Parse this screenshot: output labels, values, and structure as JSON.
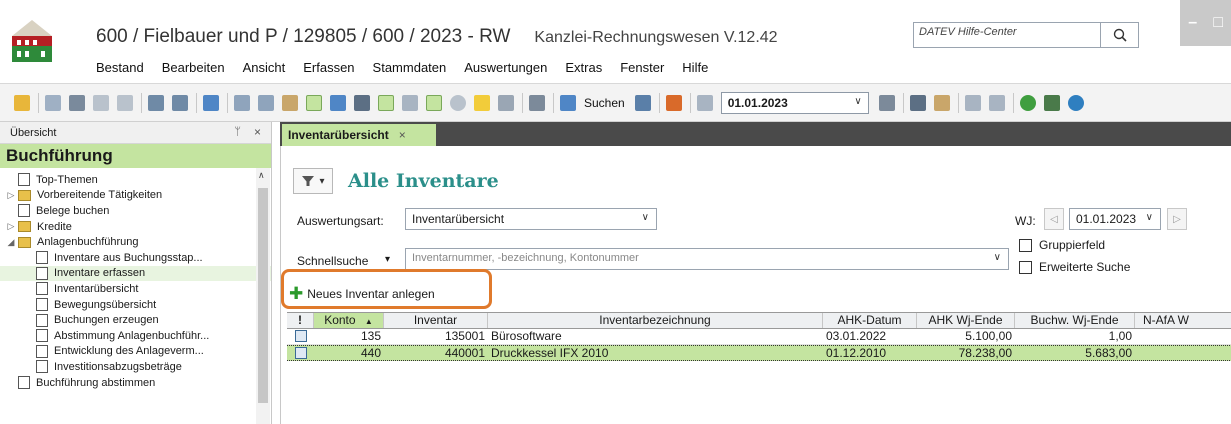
{
  "window": {
    "title_path": "600 / Fielbauer und P / 129805 / 600 / 2023 - RW",
    "product": "Kanzlei-Rechnungswesen V.12.42",
    "help_placeholder": "DATEV Hilfe-Center",
    "minimize": "–",
    "maximize": "□"
  },
  "menu": [
    "Bestand",
    "Bearbeiten",
    "Ansicht",
    "Erfassen",
    "Stammdaten",
    "Auswertungen",
    "Extras",
    "Fenster",
    "Hilfe"
  ],
  "toolbar": {
    "search_label": "Suchen",
    "date_value": "01.01.2023",
    "date_arrow": "∨"
  },
  "left_panel": {
    "header": "Übersicht",
    "pin": "ᛘ",
    "close": "×",
    "title": "Buchführung",
    "scroll_up": "∧",
    "items": [
      {
        "label": "Top-Themen",
        "expander": "",
        "icon": "doc"
      },
      {
        "label": "Vorbereitende Tätigkeiten",
        "expander": "▷",
        "icon": "folder"
      },
      {
        "label": "Belege buchen",
        "expander": "",
        "icon": "doc"
      },
      {
        "label": "Kredite",
        "expander": "▷",
        "icon": "folder"
      },
      {
        "label": "Anlagenbuchführung",
        "expander": "◢",
        "icon": "folder"
      },
      {
        "label": "Inventare aus Buchungsstap...",
        "expander": "",
        "icon": "doc"
      },
      {
        "label": "Inventare erfassen",
        "expander": "",
        "icon": "doc"
      },
      {
        "label": "Inventarübersicht",
        "expander": "",
        "icon": "doc"
      },
      {
        "label": "Bewegungsübersicht",
        "expander": "",
        "icon": "doc"
      },
      {
        "label": "Buchungen erzeugen",
        "expander": "",
        "icon": "doc"
      },
      {
        "label": "Abstimmung Anlagenbuchführ...",
        "expander": "",
        "icon": "doc"
      },
      {
        "label": "Entwicklung des Anlageverm...",
        "expander": "",
        "icon": "doc"
      },
      {
        "label": "Investitionsabzugsbeträge",
        "expander": "",
        "icon": "doc"
      },
      {
        "label": "Buchführung abstimmen",
        "expander": "",
        "icon": "doc"
      }
    ]
  },
  "doc_tab": {
    "label": "Inventarübersicht",
    "close": "×"
  },
  "content": {
    "filter_arrow": "▾",
    "heading": "Alle Inventare",
    "auswertungsart_label": "Auswertungsart:",
    "auswertungsart_value": "Inventarübersicht",
    "wj_label": "WJ:",
    "wj_value": "01.01.2023",
    "wj_prev": "◁",
    "wj_next": "▷",
    "combo_arrow": "∨",
    "schnellsuche_label": "Schnellsuche",
    "schnellsuche_arrow": "▾",
    "schnellsuche_placeholder": "Inventarnummer, -bezeichnung, Kontonummer",
    "gruppierfeld_label": "Gruppierfeld",
    "erweiterte_suche_label": "Erweiterte Suche",
    "new_button_icon": "✚",
    "new_button_label": "Neues Inventar anlegen"
  },
  "grid": {
    "columns": [
      "!",
      "Konto",
      "Inventar",
      "Inventarbezeichnung",
      "AHK-Datum",
      "AHK Wj-Ende",
      "Buchw. Wj-Ende",
      "N-AfA W"
    ],
    "sort_indicator": "▲",
    "rows": [
      {
        "konto": "135",
        "inventar": "135001",
        "bezeichnung": "Bürosoftware",
        "ahk_datum": "03.01.2022",
        "ahk_wj_ende": "5.100,00",
        "buchw_wj_ende": "1,00",
        "nafa": ""
      },
      {
        "konto": "440",
        "inventar": "440001",
        "bezeichnung": "Druckkessel IFX 2010",
        "ahk_datum": "01.12.2010",
        "ahk_wj_ende": "78.238,00",
        "buchw_wj_ende": "5.683,00",
        "nafa": ""
      }
    ]
  },
  "colors": {
    "accent_green": "#c4e4a0",
    "heading_teal": "#2b8f8a",
    "highlight_orange": "#e07a2c"
  }
}
